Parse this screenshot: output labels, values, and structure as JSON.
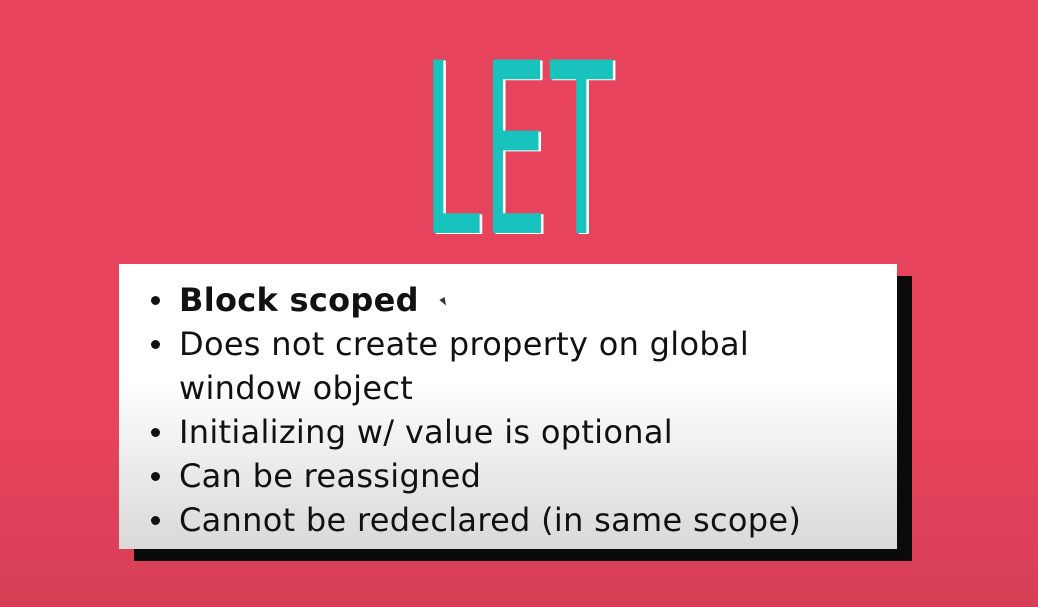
{
  "slide": {
    "title": "LET",
    "bullets": [
      {
        "text": "Block scoped",
        "bold": true
      },
      {
        "text": "Does not create property on global",
        "bold": false
      },
      {
        "text": "window object",
        "bold": false,
        "continuation": true
      },
      {
        "text": "Initializing w/ value is optional",
        "bold": false
      },
      {
        "text": "Can be reassigned",
        "bold": false
      },
      {
        "text": "Cannot be redeclared (in same scope)",
        "bold": false
      }
    ]
  },
  "colors": {
    "background": "#e8435c",
    "title": "#18c3be",
    "panel": "#ffffff",
    "panel_shadow": "#0a0a0a"
  }
}
